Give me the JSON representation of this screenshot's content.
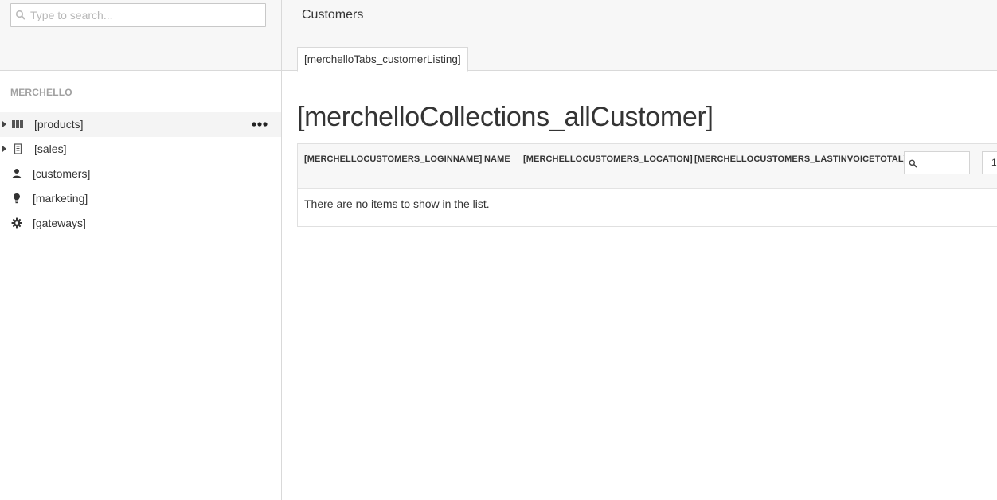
{
  "sidebar": {
    "search": {
      "placeholder": "Type to search...",
      "value": ""
    },
    "section_title": "MERCHELLO",
    "items": [
      {
        "label": "[products]",
        "icon": "barcode-icon",
        "expandable": true,
        "active": true
      },
      {
        "label": "[sales]",
        "icon": "receipt-icon",
        "expandable": true,
        "active": false
      },
      {
        "label": "[customers]",
        "icon": "user-icon",
        "expandable": false,
        "active": false
      },
      {
        "label": "[marketing]",
        "icon": "bulb-icon",
        "expandable": false,
        "active": false
      },
      {
        "label": "[gateways]",
        "icon": "gear-icon",
        "expandable": false,
        "active": false
      }
    ],
    "more_icon": "ellipsis-icon"
  },
  "header": {
    "title": "Customers",
    "tabs": [
      {
        "label": "[merchelloTabs_customerListing]",
        "active": true
      }
    ]
  },
  "main": {
    "collection_title": "[merchelloCollections_allCustomer]",
    "columns": [
      "[MERCHELLOCUSTOMERS_LOGINNAME]",
      "NAME",
      "[MERCHELLOCUSTOMERS_LOCATION]",
      "[MERCHELLOCUSTOMERS_LASTINVOICETOTAL]"
    ],
    "filter": {
      "placeholder": "",
      "value": ""
    },
    "page_number": "1",
    "empty_message": "There are no items to show in the list."
  },
  "colors": {
    "panel_bg": "#f7f7f7",
    "border": "#d9d9d9",
    "text": "#343434",
    "muted": "#a0a0a0"
  }
}
